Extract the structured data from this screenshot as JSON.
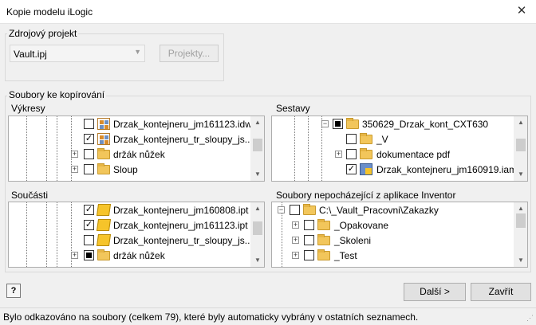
{
  "window": {
    "title": "Kopie modelu iLogic",
    "close_glyph": "✕"
  },
  "source": {
    "group_label": "Zdrojový projekt",
    "project_value": "Vault.ipj",
    "projects_button": "Projekty..."
  },
  "files": {
    "group_label": "Soubory ke kopírování",
    "vykresy": {
      "label": "Výkresy",
      "rows": [
        {
          "name": "Drzak_kontejneru_jm161123.idw",
          "checked": false,
          "icon": "idw-icon"
        },
        {
          "name": "Drzak_kontejneru_tr_sloupy_js...",
          "checked": true,
          "icon": "idw-icon"
        },
        {
          "name": "držák nůžek",
          "checked": false,
          "icon": "folder-icon",
          "expander": "+"
        },
        {
          "name": "Sloup",
          "checked": false,
          "icon": "folder-icon",
          "expander": "+"
        }
      ]
    },
    "sestavy": {
      "label": "Sestavy",
      "rows": [
        {
          "name": "350629_Drzak_kont_CXT630",
          "state": "partial",
          "icon": "folder-icon",
          "expander": "−"
        },
        {
          "name": "_V",
          "checked": false,
          "icon": "folder-icon"
        },
        {
          "name": "dokumentace pdf",
          "checked": false,
          "icon": "folder-icon",
          "expander": "+"
        },
        {
          "name": "Drzak_kontejneru_jm160919.iam",
          "checked": true,
          "icon": "iam-icon"
        }
      ]
    },
    "soucasti": {
      "label": "Součásti",
      "rows": [
        {
          "name": "Drzak_kontejneru_jm160808.ipt",
          "checked": true,
          "icon": "ipt-icon"
        },
        {
          "name": "Drzak_kontejneru_jm161123.ipt",
          "checked": true,
          "icon": "ipt-icon"
        },
        {
          "name": "Drzak_kontejneru_tr_sloupy_js...",
          "checked": false,
          "icon": "ipt-icon"
        },
        {
          "name": "držák nůžek",
          "state": "partial",
          "icon": "folder-icon",
          "expander": "+"
        }
      ]
    },
    "nepochazejici": {
      "label": "Soubory nepocházející z aplikace Inventor",
      "rows": [
        {
          "name": "C:\\_Vault_Pracovni\\Zakazky",
          "checked": false,
          "icon": "folder-icon",
          "expander": "−"
        },
        {
          "name": "_Opakovane",
          "checked": false,
          "icon": "folder-icon",
          "expander": "+"
        },
        {
          "name": "_Skoleni",
          "checked": false,
          "icon": "folder-icon",
          "expander": "+"
        },
        {
          "name": "_Test",
          "checked": false,
          "icon": "folder-icon",
          "expander": "+"
        }
      ]
    }
  },
  "buttons": {
    "next": "Další >",
    "close": "Zavřít",
    "help": "?"
  },
  "status": "Bylo odkazováno na soubory (celkem 79), které byly automaticky vybrány v ostatních seznamech."
}
